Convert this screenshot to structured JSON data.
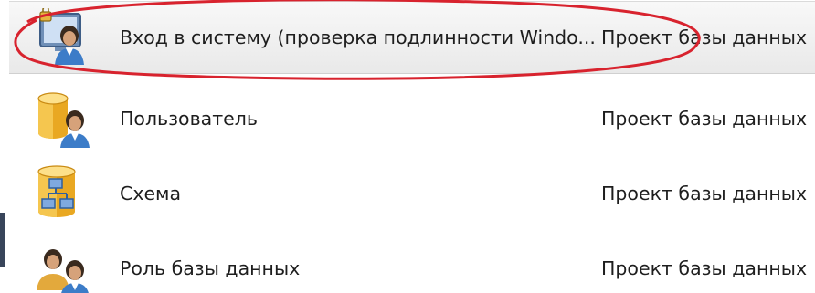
{
  "items": [
    {
      "name": "Вход в систему (проверка подлинности Windo...",
      "type": "Проект базы данных",
      "icon": "login-windows-auth-icon",
      "selected": true
    },
    {
      "name": "Пользователь",
      "type": "Проект базы данных",
      "icon": "database-user-icon",
      "selected": false
    },
    {
      "name": "Схема",
      "type": "Проект базы данных",
      "icon": "database-schema-icon",
      "selected": false
    },
    {
      "name": "Роль базы данных",
      "type": "Проект базы данных",
      "icon": "database-role-icon",
      "selected": false
    }
  ],
  "colors": {
    "annotation": "#d8232e",
    "selection": "#ececec",
    "text": "#1e1e1e"
  }
}
